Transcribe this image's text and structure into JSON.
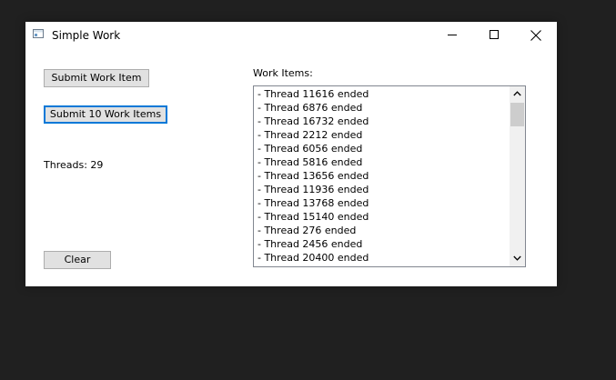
{
  "window": {
    "title": "Simple Work",
    "icon": "app-window-icon"
  },
  "caption_buttons": {
    "minimize_icon": "minimize-icon",
    "maximize_icon": "maximize-icon",
    "close_icon": "close-icon"
  },
  "controls": {
    "submit_label": "Submit Work Item",
    "submit10_label": "Submit 10 Work Items",
    "clear_label": "Clear",
    "threads_text": "Threads: 29",
    "work_items_label": "Work Items:"
  },
  "work_items": [
    "- Thread 11616 ended",
    "- Thread 6876 ended",
    "- Thread 16732 ended",
    "- Thread 2212 ended",
    "- Thread 6056 ended",
    "- Thread 5816 ended",
    "- Thread 13656 ended",
    "- Thread 11936 ended",
    "- Thread 13768 ended",
    "- Thread 15140 ended",
    "- Thread 276 ended",
    "- Thread 2456 ended",
    "- Thread 20400 ended"
  ],
  "scrollbar": {
    "up_icon": "chevron-up-icon",
    "down_icon": "chevron-down-icon"
  },
  "colors": {
    "desktop_background": "#202020",
    "default_button_border": "#0078d7",
    "button_face": "#e1e1e1"
  }
}
